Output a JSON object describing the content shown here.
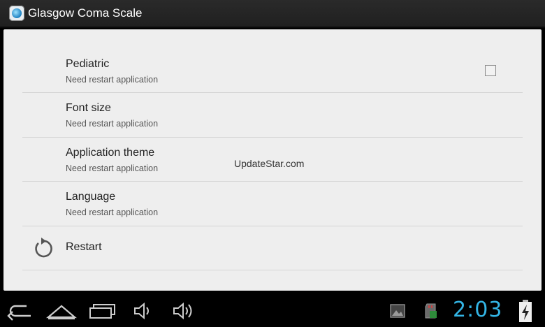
{
  "app": {
    "title": "Glasgow Coma Scale"
  },
  "preferences": [
    {
      "title": "Pediatric",
      "summary": "Need restart application",
      "checkbox": false
    },
    {
      "title": "Font size",
      "summary": "Need restart application"
    },
    {
      "title": "Application theme",
      "summary": "Need restart application"
    },
    {
      "title": "Language",
      "summary": "Need restart application"
    }
  ],
  "restart": {
    "label": "Restart",
    "icon": "restart-icon"
  },
  "watermark": "UpdateStar.com",
  "statusbar": {
    "time": "2:03"
  },
  "icons": {
    "back": "back-icon",
    "home": "home-icon",
    "recents": "recents-icon",
    "volume_down": "volume-down-icon",
    "volume_up": "volume-up-icon",
    "gallery": "gallery-notification-icon",
    "sdcard": "sdcard-notification-icon",
    "battery": "battery-charging-icon"
  },
  "colors": {
    "accent": "#33b5e5",
    "background": "#eeeeee",
    "actionbar": "#222222"
  }
}
